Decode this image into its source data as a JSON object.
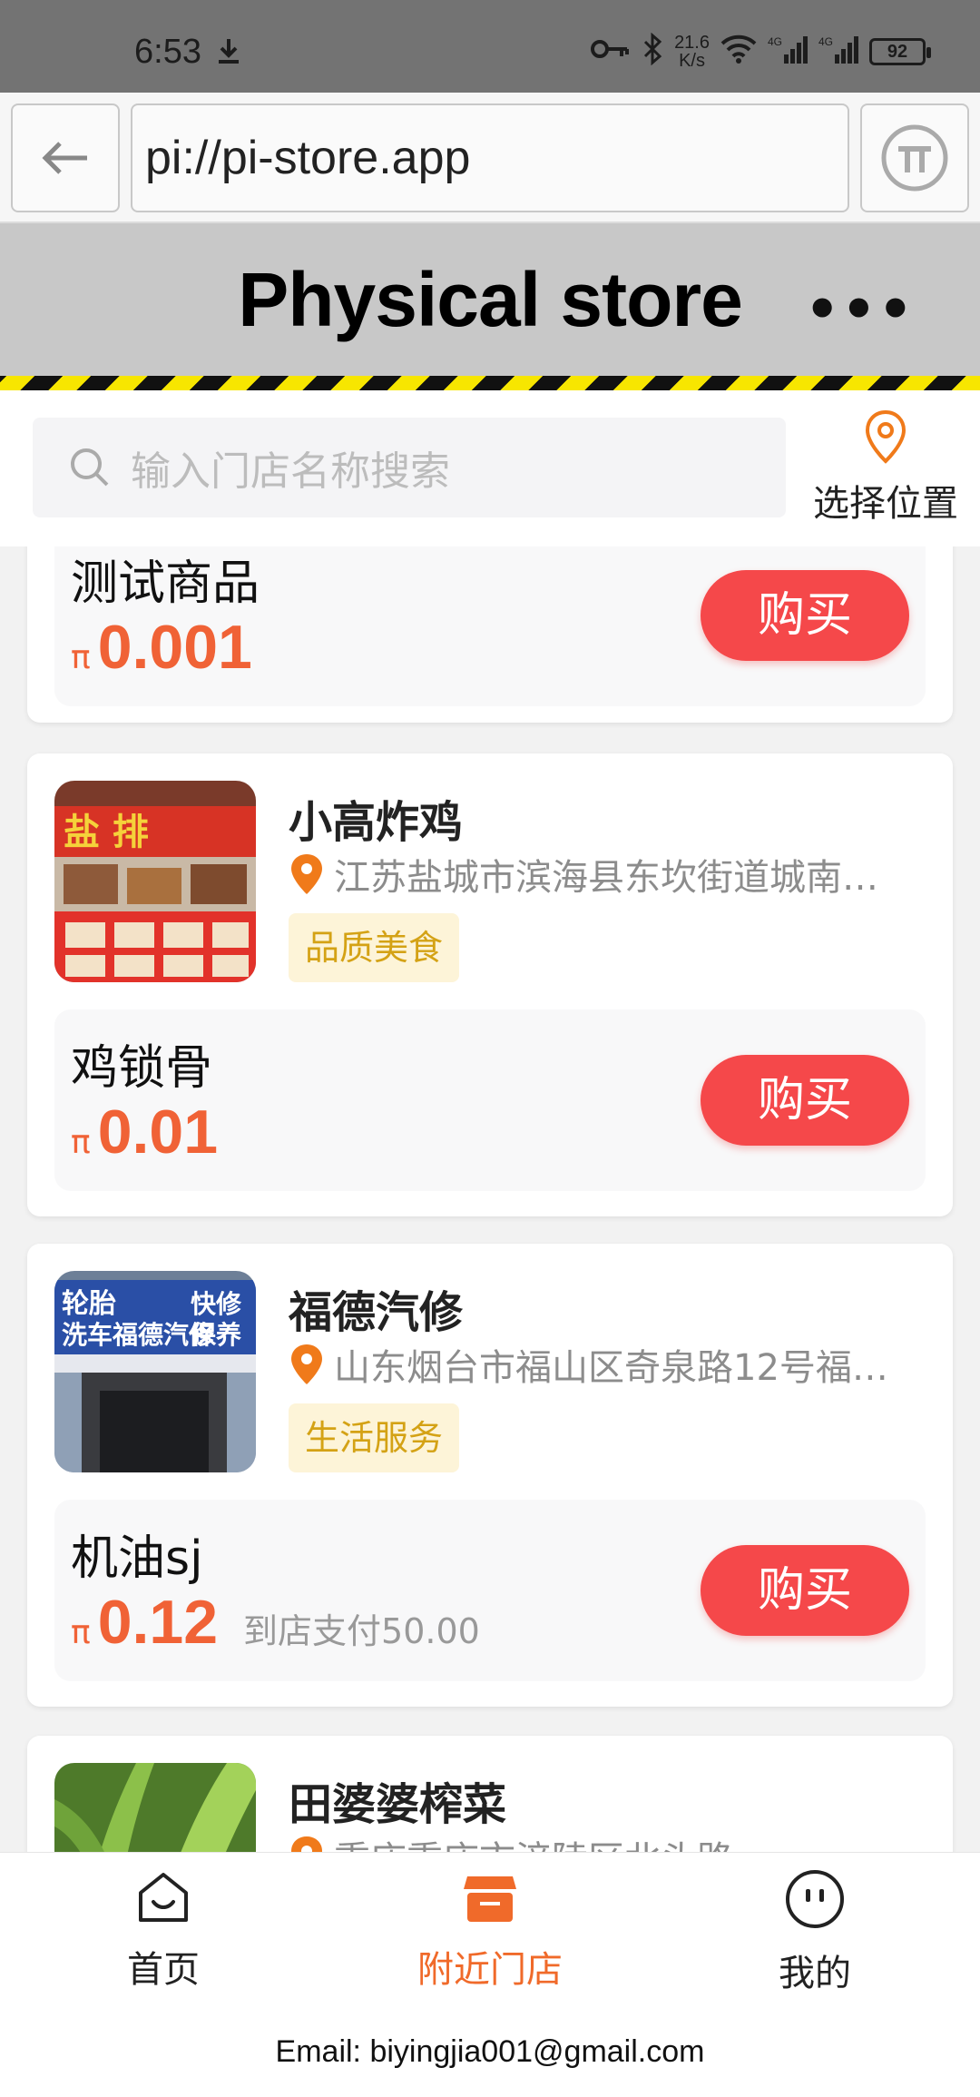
{
  "status_bar": {
    "time": "6:53",
    "net_speed_value": "21.6",
    "net_speed_unit": "K/s",
    "battery": "92"
  },
  "browser": {
    "url": "pi://pi-store.app"
  },
  "header": {
    "title": "Physical store",
    "more": "•••"
  },
  "search": {
    "placeholder": "输入门店名称搜索",
    "location_label": "选择位置"
  },
  "stores": [
    {
      "name": "",
      "product": {
        "name": "测试商品",
        "price": "0.001",
        "note": "",
        "buy_label": "购买"
      }
    },
    {
      "name": "小高炸鸡",
      "address": "江苏盐城市滨海县东坎街道城南…",
      "tag": "品质美食",
      "product": {
        "name": "鸡锁骨",
        "price": "0.01",
        "note": "",
        "buy_label": "购买"
      }
    },
    {
      "name": "福德汽修",
      "address": "山东烟台市福山区奇泉路12号福…",
      "tag": "生活服务",
      "product": {
        "name": "机油sj",
        "price": "0.12",
        "note": "到店支付50.00",
        "buy_label": "购买"
      }
    },
    {
      "name": "田婆婆榨菜",
      "address": "重庆重庆市涪陵区北头路"
    }
  ],
  "price_symbol": "π",
  "bottom_nav": {
    "items": [
      {
        "label": "首页",
        "icon": "home-icon"
      },
      {
        "label": "附近门店",
        "icon": "store-icon"
      },
      {
        "label": "我的",
        "icon": "profile-icon"
      }
    ],
    "active_index": 1
  },
  "footer": {
    "email": "Email: biyingjia001@gmail.com"
  },
  "colors": {
    "accent": "#f06236",
    "buy_button": "#f5484a",
    "tag_text": "#d4a215",
    "tag_bg": "#fdf4d8",
    "pin": "#f07a1a"
  }
}
